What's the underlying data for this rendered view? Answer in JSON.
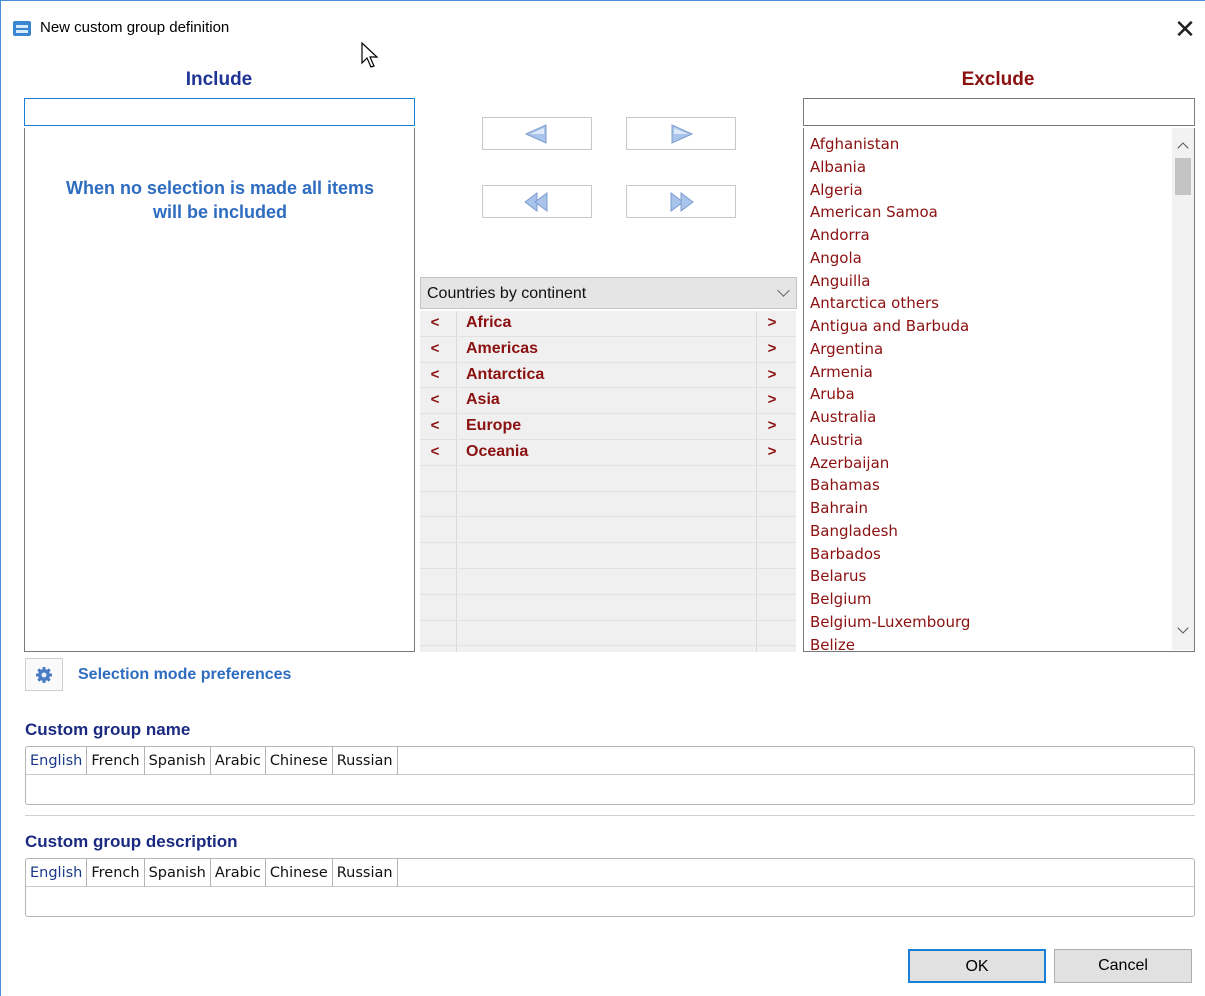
{
  "window": {
    "title": "New custom group definition"
  },
  "include": {
    "heading": "Include",
    "empty_message": "When no selection is made all items will be included"
  },
  "exclude": {
    "heading": "Exclude",
    "items": [
      "Afghanistan",
      "Albania",
      "Algeria",
      "American Samoa",
      "Andorra",
      "Angola",
      "Anguilla",
      "Antarctica others",
      "Antigua and Barbuda",
      "Argentina",
      "Armenia",
      "Aruba",
      "Australia",
      "Austria",
      "Azerbaijan",
      "Bahamas",
      "Bahrain",
      "Bangladesh",
      "Barbados",
      "Belarus",
      "Belgium",
      "Belgium-Luxembourg",
      "Belize"
    ]
  },
  "group_selector": {
    "selected": "Countries by continent",
    "groups": [
      "Africa",
      "Americas",
      "Antarctica",
      "Asia",
      "Europe",
      "Oceania"
    ],
    "add_symbol": "<",
    "remove_symbol": ">"
  },
  "selection_mode": {
    "label": "Selection mode preferences"
  },
  "custom_group_name": {
    "label": "Custom group name",
    "tabs": [
      "English",
      "French",
      "Spanish",
      "Arabic",
      "Chinese",
      "Russian"
    ],
    "active_tab": "English"
  },
  "custom_group_description": {
    "label": "Custom group description",
    "tabs": [
      "English",
      "French",
      "Spanish",
      "Arabic",
      "Chinese",
      "Russian"
    ],
    "active_tab": "English"
  },
  "buttons": {
    "ok": "OK",
    "cancel": "Cancel"
  },
  "colors": {
    "include_blue": "#1f3596",
    "exclude_red": "#8b1010",
    "accent": "#1a7fd4"
  }
}
